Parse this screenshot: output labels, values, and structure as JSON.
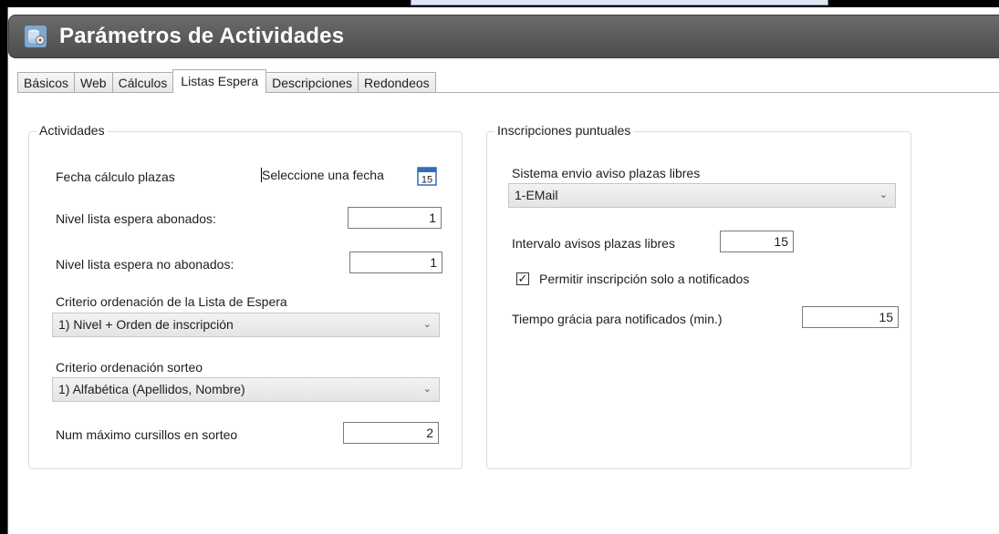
{
  "window": {
    "title": "Parámetros de Actividades"
  },
  "tabs": [
    {
      "label": "Básicos"
    },
    {
      "label": "Web"
    },
    {
      "label": "Cálculos"
    },
    {
      "label": "Listas Espera"
    },
    {
      "label": "Descripciones"
    },
    {
      "label": "Redondeos"
    }
  ],
  "active_tab": "Listas Espera",
  "actividades": {
    "title": "Actividades",
    "fecha_label": "Fecha cálculo plazas",
    "fecha_placeholder": "Seleccione una fecha",
    "calendar_day": "15",
    "nivel_abonados_label": "Nivel lista espera abonados:",
    "nivel_abonados_value": "1",
    "nivel_no_abonados_label": "Nivel lista espera no abonados:",
    "nivel_no_abonados_value": "1",
    "criterio_lista_label": "Criterio ordenación de la Lista de Espera",
    "criterio_lista_value": "1) Nivel + Orden de inscripción",
    "criterio_sorteo_label": "Criterio ordenación sorteo",
    "criterio_sorteo_value": "1) Alfabética (Apellidos, Nombre)",
    "max_cursillos_label": "Num máximo cursillos en sorteo",
    "max_cursillos_value": "2"
  },
  "inscripciones": {
    "title": "Inscripciones puntuales",
    "sistema_label": "Sistema envio aviso plazas libres",
    "sistema_value": "1-EMail",
    "intervalo_label": "Intervalo avisos plazas libres",
    "intervalo_value": "15",
    "permitir_label": "Permitir inscripción solo a notificados",
    "permitir_checked": true,
    "tiempo_label": "Tiempo grácia para notificados (min.)",
    "tiempo_value": "15"
  },
  "colors": {
    "titlebar": "#5a5a5a",
    "group_border": "#d5dfe5",
    "calendar_blue": "#2f6fb8"
  }
}
